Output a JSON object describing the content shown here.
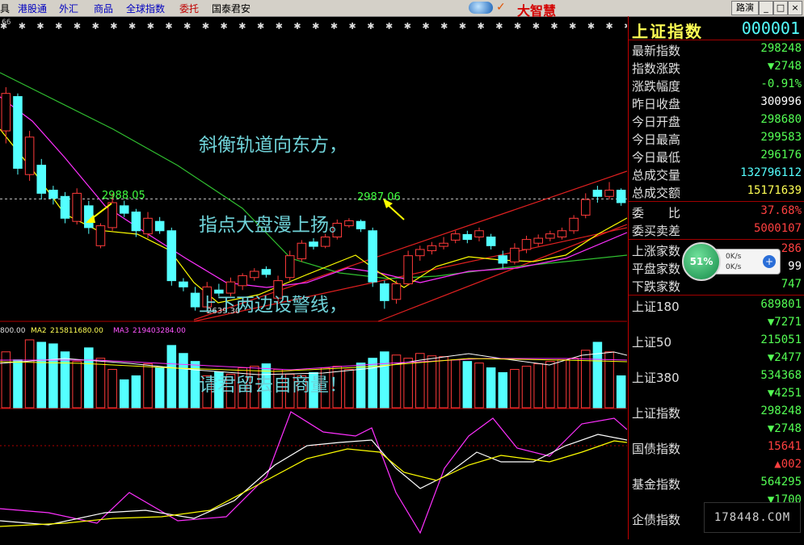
{
  "menu": [
    "具",
    "港股通",
    "外汇",
    "商品",
    "全球指数",
    "委托",
    "国泰君安"
  ],
  "brand": {
    "mark": "✓",
    "name": "大智慧"
  },
  "window_buttons": {
    "route": "路演",
    "min": "_",
    "max": "□",
    "close": "×"
  },
  "chart": {
    "corner_label": "66",
    "dot_row": "✱ ✱ ✱ ✱ ✱ ✱ ✱ ✱ ✱ ✱ ✱ ✱ ✱ ✱ ✱ ✱ ✱ ✱ ✱ ✱ ✱ ✱ ✱ ✱ ✱ ✱ ✱ ✱ ✱ ✱ ✱ ✱ ✱ ✱ ✱ ✱ ✱ ✱ ✱ ✱ ✱ ✱ ✱ ✱ ✱ ✱ ✱ ✱ ✱ ✱ ✱ ✱ ✱ ✱ ✱ ✱ ✱ ✱ ✱ ✱ ✱",
    "poem": [
      "斜衡轨道向东方，",
      "指点大盘漫上扬。",
      "上下两边设警线，",
      "请君留去自商量！"
    ],
    "annotations": {
      "high1": "2988.05",
      "high2": "2987.06",
      "low": "2639.30"
    },
    "volume_header": {
      "ma1": "800.00",
      "ma2_label": "MA2",
      "ma2": "215811680.00",
      "ma3_label": "MA3",
      "ma3": "219403284.00"
    },
    "colors": {
      "up": "#ff3a3a",
      "down": "#54ffff",
      "ma_white": "#ffffff",
      "ma_yellow": "#ffff00",
      "ma_magenta": "#ff30ff",
      "ma_green": "#30c030"
    }
  },
  "chart_data": {
    "type": "candlestick",
    "candles": [
      {
        "o": 2860,
        "c": 2920,
        "h": 2930,
        "l": 2840,
        "up": true
      },
      {
        "o": 2915,
        "c": 2800,
        "h": 2920,
        "l": 2790,
        "up": false
      },
      {
        "o": 2790,
        "c": 2850,
        "h": 2860,
        "l": 2780,
        "up": true
      },
      {
        "o": 2805,
        "c": 2760,
        "h": 2815,
        "l": 2750,
        "up": false
      },
      {
        "o": 2765,
        "c": 2752,
        "h": 2772,
        "l": 2742,
        "up": false
      },
      {
        "o": 2755,
        "c": 2720,
        "h": 2762,
        "l": 2712,
        "up": false
      },
      {
        "o": 2715,
        "c": 2760,
        "h": 2768,
        "l": 2710,
        "up": true
      },
      {
        "o": 2740,
        "c": 2705,
        "h": 2748,
        "l": 2695,
        "up": false
      },
      {
        "o": 2676,
        "c": 2708,
        "h": 2712,
        "l": 2672,
        "up": true
      },
      {
        "o": 2705,
        "c": 2745,
        "h": 2760,
        "l": 2700,
        "up": true
      },
      {
        "o": 2740,
        "c": 2728,
        "h": 2748,
        "l": 2722,
        "up": false
      },
      {
        "o": 2730,
        "c": 2700,
        "h": 2735,
        "l": 2690,
        "up": false
      },
      {
        "o": 2695,
        "c": 2720,
        "h": 2730,
        "l": 2688,
        "up": true
      },
      {
        "o": 2715,
        "c": 2700,
        "h": 2722,
        "l": 2695,
        "up": false
      },
      {
        "o": 2700,
        "c": 2620,
        "h": 2705,
        "l": 2612,
        "up": false
      },
      {
        "o": 2618,
        "c": 2610,
        "h": 2624,
        "l": 2603,
        "up": false
      },
      {
        "o": 2600,
        "c": 2578,
        "h": 2610,
        "l": 2572,
        "up": false
      },
      {
        "o": 2578,
        "c": 2610,
        "h": 2618,
        "l": 2568,
        "up": true
      },
      {
        "o": 2605,
        "c": 2600,
        "h": 2615,
        "l": 2595,
        "up": false
      },
      {
        "o": 2600,
        "c": 2618,
        "h": 2625,
        "l": 2595,
        "up": true
      },
      {
        "o": 2612,
        "c": 2628,
        "h": 2632,
        "l": 2605,
        "up": true
      },
      {
        "o": 2625,
        "c": 2635,
        "h": 2640,
        "l": 2620,
        "up": true
      },
      {
        "o": 2638,
        "c": 2630,
        "h": 2643,
        "l": 2625,
        "up": false
      },
      {
        "o": 2592,
        "c": 2620,
        "h": 2628,
        "l": 2586,
        "up": true
      },
      {
        "o": 2625,
        "c": 2660,
        "h": 2668,
        "l": 2620,
        "up": true
      },
      {
        "o": 2655,
        "c": 2680,
        "h": 2685,
        "l": 2650,
        "up": true
      },
      {
        "o": 2682,
        "c": 2675,
        "h": 2688,
        "l": 2670,
        "up": false
      },
      {
        "o": 2675,
        "c": 2690,
        "h": 2695,
        "l": 2672,
        "up": true
      },
      {
        "o": 2690,
        "c": 2712,
        "h": 2718,
        "l": 2686,
        "up": true
      },
      {
        "o": 2708,
        "c": 2716,
        "h": 2720,
        "l": 2705,
        "up": true
      },
      {
        "o": 2715,
        "c": 2703,
        "h": 2718,
        "l": 2698,
        "up": false
      },
      {
        "o": 2700,
        "c": 2618,
        "h": 2705,
        "l": 2610,
        "up": false
      },
      {
        "o": 2615,
        "c": 2588,
        "h": 2620,
        "l": 2575,
        "up": false
      },
      {
        "o": 2590,
        "c": 2615,
        "h": 2620,
        "l": 2583,
        "up": true
      },
      {
        "o": 2615,
        "c": 2660,
        "h": 2668,
        "l": 2612,
        "up": true
      },
      {
        "o": 2660,
        "c": 2670,
        "h": 2676,
        "l": 2652,
        "up": true
      },
      {
        "o": 2668,
        "c": 2676,
        "h": 2682,
        "l": 2662,
        "up": true
      },
      {
        "o": 2675,
        "c": 2680,
        "h": 2690,
        "l": 2670,
        "up": true
      },
      {
        "o": 2685,
        "c": 2695,
        "h": 2700,
        "l": 2680,
        "up": true
      },
      {
        "o": 2694,
        "c": 2686,
        "h": 2700,
        "l": 2680,
        "up": false
      },
      {
        "o": 2690,
        "c": 2700,
        "h": 2705,
        "l": 2683,
        "up": true
      },
      {
        "o": 2690,
        "c": 2676,
        "h": 2695,
        "l": 2670,
        "up": false
      },
      {
        "o": 2660,
        "c": 2648,
        "h": 2668,
        "l": 2640,
        "up": false
      },
      {
        "o": 2650,
        "c": 2672,
        "h": 2680,
        "l": 2646,
        "up": true
      },
      {
        "o": 2670,
        "c": 2686,
        "h": 2692,
        "l": 2664,
        "up": true
      },
      {
        "o": 2680,
        "c": 2688,
        "h": 2694,
        "l": 2675,
        "up": true
      },
      {
        "o": 2688,
        "c": 2695,
        "h": 2700,
        "l": 2683,
        "up": true
      },
      {
        "o": 2690,
        "c": 2700,
        "h": 2705,
        "l": 2686,
        "up": true
      },
      {
        "o": 2700,
        "c": 2720,
        "h": 2725,
        "l": 2695,
        "up": true
      },
      {
        "o": 2725,
        "c": 2750,
        "h": 2760,
        "l": 2720,
        "up": true
      },
      {
        "o": 2765,
        "c": 2755,
        "h": 2772,
        "l": 2745,
        "up": false
      },
      {
        "o": 2755,
        "c": 2765,
        "h": 2778,
        "l": 2750,
        "up": true
      },
      {
        "o": 2765,
        "c": 2745,
        "h": 2768,
        "l": 2740,
        "up": false
      }
    ],
    "reference_price": 2751,
    "volume": [
      70,
      60,
      85,
      82,
      80,
      70,
      58,
      75,
      62,
      48,
      35,
      40,
      55,
      50,
      78,
      68,
      58,
      40,
      45,
      42,
      50,
      52,
      55,
      48,
      42,
      40,
      44,
      50,
      52,
      48,
      56,
      62,
      70,
      66,
      62,
      68,
      65,
      64,
      60,
      58,
      56,
      50,
      44,
      48,
      52,
      55,
      58,
      60,
      62,
      72,
      82,
      70,
      40
    ]
  },
  "panel": {
    "title": "上证指数",
    "code": "000001",
    "quotes": [
      {
        "label": "最新指数",
        "value": "298248",
        "cls": "gr"
      },
      {
        "label": "指数涨跌",
        "value": "▼2748",
        "cls": "gr"
      },
      {
        "label": "涨跌幅度",
        "value": "-0.91%",
        "cls": "gr"
      },
      {
        "label": "昨日收盘",
        "value": "300996",
        "cls": "wh"
      },
      {
        "label": "今日开盘",
        "value": "298680",
        "cls": "gr"
      },
      {
        "label": "今日最高",
        "value": "299583",
        "cls": "gr"
      },
      {
        "label": "今日最低",
        "value": "296176",
        "cls": "gr"
      },
      {
        "label": "总成交量",
        "value": "132796112",
        "cls": "cy"
      },
      {
        "label": "总成交额",
        "value": "15171639",
        "cls": "yl"
      }
    ],
    "bid": [
      {
        "label": "委　　比",
        "value": "37.68%",
        "cls": "rd"
      },
      {
        "label": "委买卖差",
        "value": "5000107",
        "cls": "rd"
      }
    ],
    "breadth": [
      {
        "label": "上涨家数",
        "value": "286",
        "cls": "rd"
      },
      {
        "label": "平盘家数",
        "value": "99",
        "cls": "wh"
      },
      {
        "label": "下跌家数",
        "value": "747",
        "cls": "gr"
      }
    ],
    "indices": [
      {
        "label": "上证180",
        "value": "689801",
        "change": "▼7271",
        "cls": "gr"
      },
      {
        "label": "上证50",
        "value": "215051",
        "change": "▼2477",
        "cls": "gr"
      },
      {
        "label": "上证380",
        "value": "534368",
        "change": "▼4251",
        "cls": "gr"
      },
      {
        "label": "上证指数",
        "value": "298248",
        "change": "▼2748",
        "cls": "gr"
      },
      {
        "label": "国债指数",
        "value": "15641",
        "change": "▲002",
        "cls": "rd"
      },
      {
        "label": "基金指数",
        "value": "564295",
        "change": "▼1700",
        "cls": "gr"
      },
      {
        "label": "企债指数",
        "value": "",
        "change": "",
        "cls": "gr"
      }
    ]
  },
  "speedball": {
    "percent": "51%",
    "up": "0K/s",
    "down": "0K/s",
    "plus": "+"
  },
  "watermark": "178448.COM"
}
